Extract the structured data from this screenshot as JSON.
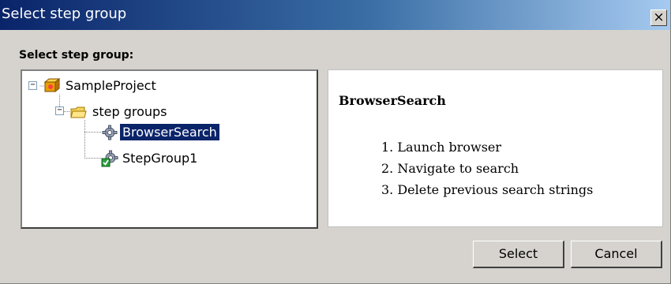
{
  "window": {
    "title": "Select step group",
    "close_label": "×"
  },
  "section_label": "Select step group:",
  "tree": {
    "nodes": [
      {
        "label": "SampleProject",
        "icon": "project-icon",
        "expander": "−"
      },
      {
        "label": "step groups",
        "icon": "folder-icon",
        "expander": "−"
      },
      {
        "label": "BrowserSearch",
        "icon": "gear-icon",
        "selected": true
      },
      {
        "label": "StepGroup1",
        "icon": "gear-check-icon"
      }
    ]
  },
  "details": {
    "title": "BrowserSearch",
    "steps": [
      "1. Launch browser",
      "2. Navigate to search",
      "3. Delete previous search strings"
    ]
  },
  "buttons": {
    "select": "Select",
    "cancel": "Cancel"
  },
  "colors": {
    "title_bar_start": "#0a246a",
    "title_bar_end": "#a6caf0",
    "selection": "#0a246a",
    "dialog_bg": "#d6d3ce"
  }
}
